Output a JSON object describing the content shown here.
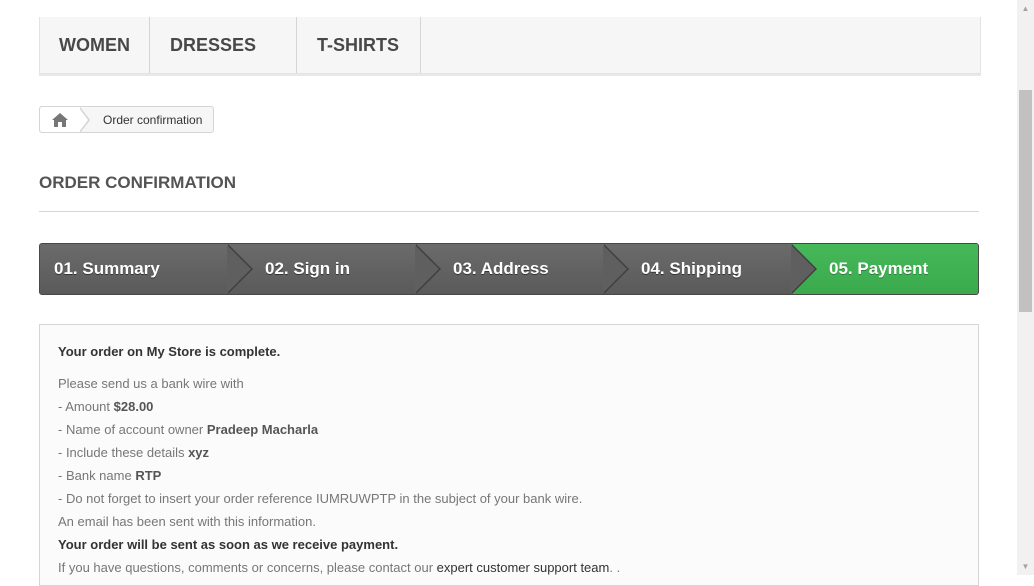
{
  "nav": {
    "items": [
      "WOMEN",
      "DRESSES",
      "T-SHIRTS"
    ]
  },
  "breadcrumb": {
    "home_icon": "home-icon",
    "current": "Order confirmation"
  },
  "page_heading": "ORDER CONFIRMATION",
  "steps": [
    "01. Summary",
    "02. Sign in",
    "03. Address",
    "04. Shipping",
    "05. Payment"
  ],
  "active_step_color": "#3cab4f",
  "confirmation": {
    "title_prefix": "Your order on ",
    "title_store": "My Store",
    "title_suffix": " is complete.",
    "intro": "Please send us a bank wire with",
    "amount_label": "- Amount ",
    "amount_value": "$28.00",
    "owner_label": "- Name of account owner ",
    "owner_value": "Pradeep Macharla",
    "details_label": "- Include these details ",
    "details_value": "xyz",
    "bank_label": "- Bank name ",
    "bank_value": "RTP",
    "reference_line": "- Do not forget to insert your order reference IUMRUWPTP in the subject of your bank wire.",
    "email_line": "An email has been sent with this information.",
    "sent_line": "Your order will be sent as soon as we receive payment.",
    "contact_prefix": "If you have questions, comments or concerns, please contact our ",
    "contact_link": "expert customer support team",
    "contact_suffix": ". ."
  }
}
